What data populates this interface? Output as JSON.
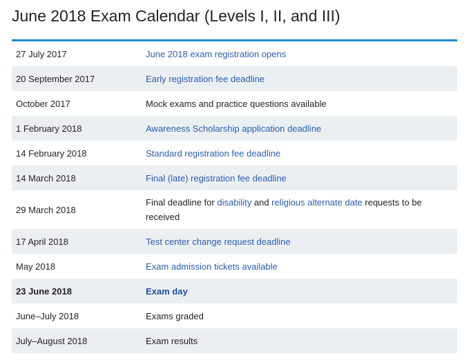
{
  "page": {
    "title": "June 2018 Exam Calendar (Levels I, II, and III)"
  },
  "colors": {
    "accent_rule": "#1c8ccf",
    "link": "#2a5db0",
    "row_shade": "#eceff2",
    "text": "#222222"
  },
  "rows": [
    {
      "date": "27 July 2017",
      "event": "June 2018 exam registration opens"
    },
    {
      "date": "20 September 2017",
      "event": "Early registration fee deadline"
    },
    {
      "date": "October 2017",
      "event": "Mock exams and practice questions available"
    },
    {
      "date": "1 February 2018",
      "event": "Awareness Scholarship application deadline"
    },
    {
      "date": "14 February 2018",
      "event": "Standard registration fee deadline"
    },
    {
      "date": "14 March 2018",
      "event": "Final (late) registration fee deadline"
    },
    {
      "date": "29 March 2018",
      "event_parts": {
        "p1": "Final deadline for ",
        "link1": "disability",
        "p2": " and ",
        "link2": "religious alternate date",
        "p3": " requests to be received"
      }
    },
    {
      "date": "17 April 2018",
      "event": "Test center change request deadline"
    },
    {
      "date": "May 2018",
      "event": "Exam admission tickets available"
    },
    {
      "date": "23 June 2018",
      "event": "Exam day"
    },
    {
      "date": "June–July 2018",
      "event": "Exams graded"
    },
    {
      "date": "July–August 2018",
      "event": "Exam results"
    }
  ]
}
